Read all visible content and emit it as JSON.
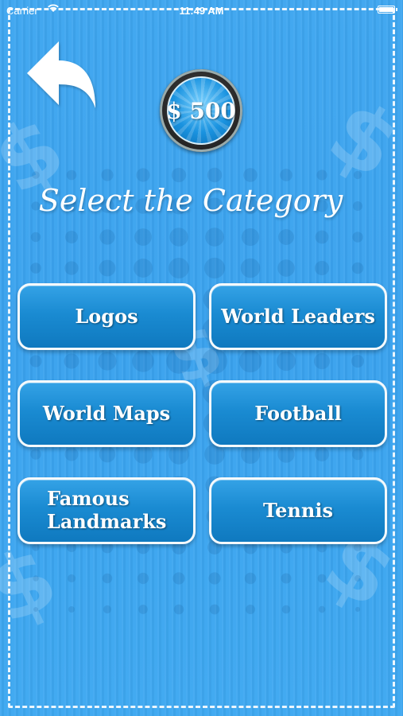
{
  "status_bar": {
    "carrier": "Carrier",
    "wifi_icon": "wifi-icon",
    "time": "11:49 AM",
    "battery_icon": "battery-icon",
    "battery_level": 1.0
  },
  "header": {
    "back_icon": "curved-back-arrow-icon",
    "coins": "$ 500"
  },
  "title": "Select the Category",
  "categories": [
    {
      "label": "Logos"
    },
    {
      "label": "World Leaders"
    },
    {
      "label": "World Maps"
    },
    {
      "label": "Football"
    },
    {
      "label": "Famous\nLandmarks"
    },
    {
      "label": "Tennis"
    }
  ],
  "colors": {
    "background": "#3ca5ef",
    "button": "#1a8bd2",
    "button_border": "#f4f9fc",
    "text": "#ffffff"
  }
}
